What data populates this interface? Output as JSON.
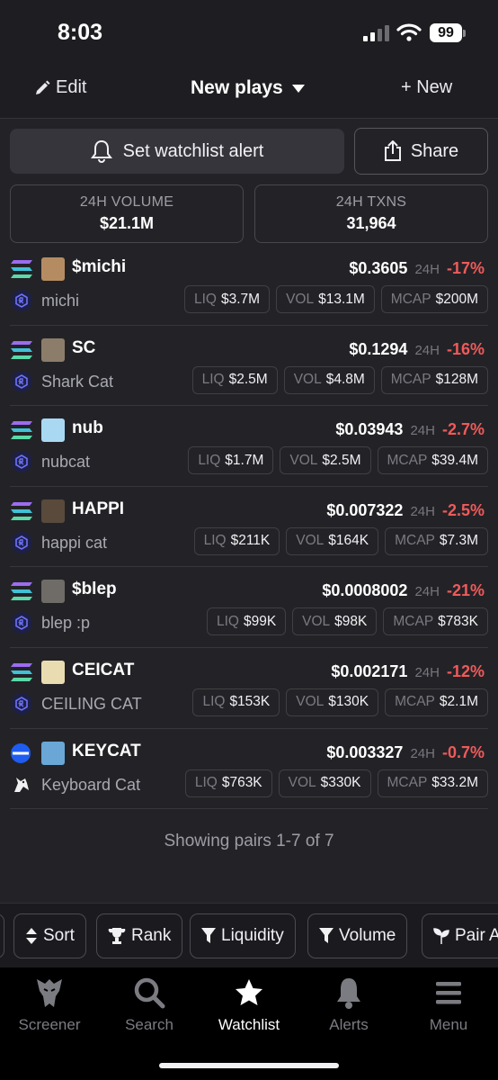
{
  "status": {
    "time": "8:03",
    "battery": "99"
  },
  "nav": {
    "edit_label": "Edit",
    "title": "New plays",
    "new_label": "+ New"
  },
  "actions": {
    "alert_label": "Set watchlist alert",
    "share_label": "Share"
  },
  "stats": {
    "volume": {
      "label": "24H VOLUME",
      "value": "$21.1M"
    },
    "txns": {
      "label": "24H TXNS",
      "value": "31,964"
    }
  },
  "labels": {
    "change": "24H",
    "liq": "LIQ",
    "vol": "VOL",
    "mcap": "MCAP"
  },
  "tokens": [
    {
      "symbol": "$michi",
      "name": "michi",
      "price": "$0.3605",
      "change": "-17%",
      "liq": "$3.7M",
      "vol": "$13.1M",
      "mcap": "$200M",
      "chain": "solana-icon",
      "dex": "raydium-icon",
      "avatar_color": "#b58c62"
    },
    {
      "symbol": "SC",
      "name": "Shark Cat",
      "price": "$0.1294",
      "change": "-16%",
      "liq": "$2.5M",
      "vol": "$4.8M",
      "mcap": "$128M",
      "chain": "solana-icon",
      "dex": "raydium-icon",
      "avatar_color": "#8c7d6a"
    },
    {
      "symbol": "nub",
      "name": "nubcat",
      "price": "$0.03943",
      "change": "-2.7%",
      "liq": "$1.7M",
      "vol": "$2.5M",
      "mcap": "$39.4M",
      "chain": "solana-icon",
      "dex": "raydium-icon",
      "avatar_color": "#a9d8f2"
    },
    {
      "symbol": "HAPPI",
      "name": "happi cat",
      "price": "$0.007322",
      "change": "-2.5%",
      "liq": "$211K",
      "vol": "$164K",
      "mcap": "$7.3M",
      "chain": "solana-icon",
      "dex": "raydium-icon",
      "avatar_color": "#5a4a3c"
    },
    {
      "symbol": "$blep",
      "name": "blep :p",
      "price": "$0.0008002",
      "change": "-21%",
      "liq": "$99K",
      "vol": "$98K",
      "mcap": "$783K",
      "chain": "solana-icon",
      "dex": "raydium-icon",
      "avatar_color": "#6f6b66"
    },
    {
      "symbol": "CEICAT",
      "name": "CEILING CAT",
      "price": "$0.002171",
      "change": "-12%",
      "liq": "$153K",
      "vol": "$130K",
      "mcap": "$2.1M",
      "chain": "solana-icon",
      "dex": "raydium-icon",
      "avatar_color": "#e9dcb0"
    },
    {
      "symbol": "KEYCAT",
      "name": "Keyboard Cat",
      "price": "$0.003327",
      "change": "-0.7%",
      "liq": "$763K",
      "vol": "$330K",
      "mcap": "$33.2M",
      "chain": "base-icon",
      "dex": "unicorn-icon",
      "avatar_color": "#6aa7d6"
    }
  ],
  "footer_text": "Showing pairs 1-7 of 7",
  "filters": [
    "Sort",
    "Rank",
    "Liquidity",
    "Volume",
    "Pair A"
  ],
  "tabs": [
    {
      "label": "Screener",
      "icon": "eagle-icon"
    },
    {
      "label": "Search",
      "icon": "search-icon"
    },
    {
      "label": "Watchlist",
      "icon": "star-icon"
    },
    {
      "label": "Alerts",
      "icon": "bell-icon"
    },
    {
      "label": "Menu",
      "icon": "menu-icon"
    }
  ],
  "colors": {
    "negative": "#ef5a5a",
    "background": "#232327",
    "tab_active": "#ffffff"
  }
}
